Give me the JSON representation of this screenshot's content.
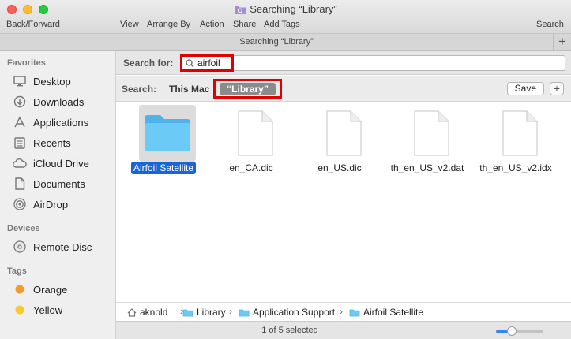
{
  "window": {
    "title": "Searching “Library”",
    "toolbar": {
      "back_forward": "Back/Forward",
      "view": "View",
      "arrange_by": "Arrange By",
      "action": "Action",
      "share": "Share",
      "add_tags": "Add Tags",
      "search": "Search"
    },
    "tab_title": "Searching “Library”",
    "tab_add": "+"
  },
  "sidebar": {
    "favorites_heading": "Favorites",
    "favorites": [
      {
        "label": "Desktop",
        "icon": "desktop-icon"
      },
      {
        "label": "Downloads",
        "icon": "downloads-icon"
      },
      {
        "label": "Applications",
        "icon": "applications-icon"
      },
      {
        "label": "Recents",
        "icon": "recents-icon"
      },
      {
        "label": "iCloud Drive",
        "icon": "icloud-icon"
      },
      {
        "label": "Documents",
        "icon": "documents-icon"
      },
      {
        "label": "AirDrop",
        "icon": "airdrop-icon"
      }
    ],
    "devices_heading": "Devices",
    "devices": [
      {
        "label": "Remote Disc",
        "icon": "disc-icon"
      }
    ],
    "tags_heading": "Tags",
    "tags": [
      {
        "label": "Orange",
        "color": "#f39a2b"
      },
      {
        "label": "Yellow",
        "color": "#f6cb2b"
      }
    ]
  },
  "search": {
    "label": "Search for:",
    "query": "airfoil"
  },
  "scope": {
    "label": "Search:",
    "this_mac": "This Mac",
    "library": "“Library”",
    "save": "Save",
    "add": "+"
  },
  "files": [
    {
      "name": "Airfoil Satellite",
      "kind": "folder",
      "selected": true
    },
    {
      "name": "en_CA.dic",
      "kind": "document",
      "selected": false
    },
    {
      "name": "en_US.dic",
      "kind": "document",
      "selected": false
    },
    {
      "name": "th_en_US_v2.dat",
      "kind": "document",
      "selected": false
    },
    {
      "name": "th_en_US_v2.idx",
      "kind": "document",
      "selected": false
    }
  ],
  "path": [
    {
      "label": "aknold",
      "icon": "home-icon"
    },
    {
      "label": "Library",
      "icon": "folder-icon"
    },
    {
      "label": "Application Support",
      "icon": "folder-icon"
    },
    {
      "label": "Airfoil Satellite",
      "icon": "folder-icon"
    }
  ],
  "status": {
    "text": "1 of 5 selected",
    "icon_size_fraction": 0.3
  },
  "colors": {
    "selection": "#1b64d6",
    "highlight_box": "#e00000",
    "folder": "#5fc4f4"
  }
}
